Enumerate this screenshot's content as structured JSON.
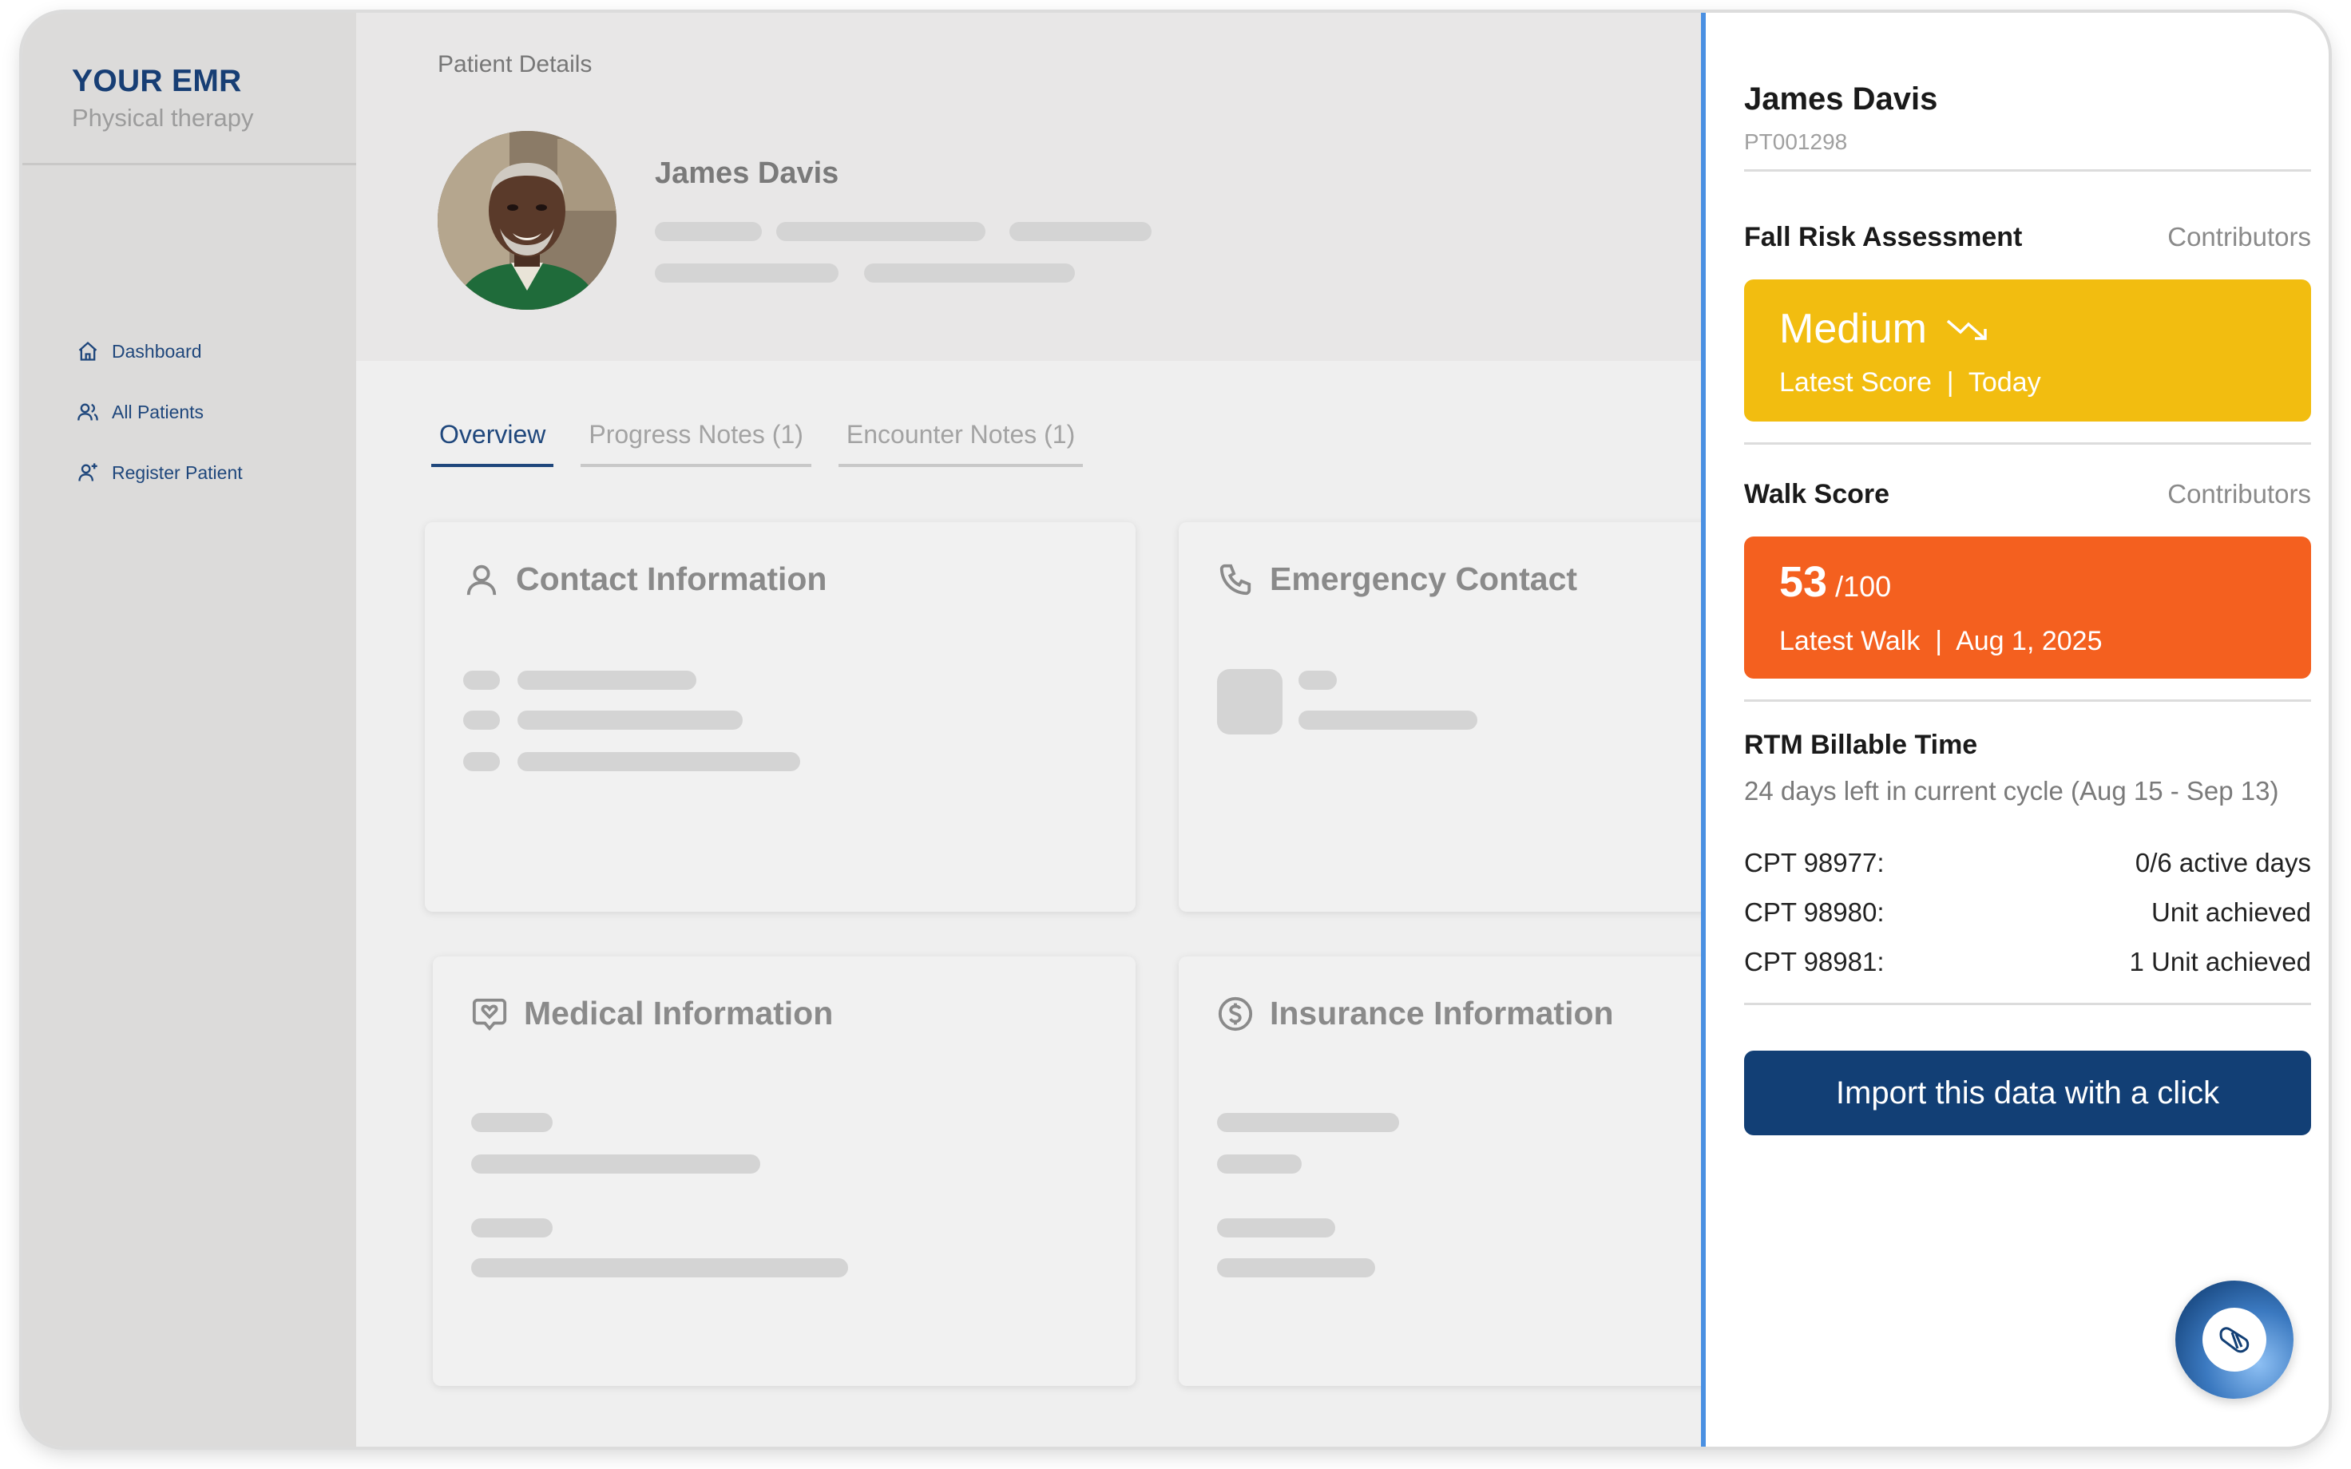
{
  "app": {
    "brand_title": "YOUR EMR",
    "brand_subtitle": "Physical therapy"
  },
  "sidebar": {
    "items": [
      {
        "label": "Dashboard",
        "icon": "home-icon"
      },
      {
        "label": "All Patients",
        "icon": "users-icon"
      },
      {
        "label": "Register Patient",
        "icon": "user-plus-icon"
      }
    ]
  },
  "main": {
    "page_title": "Patient Details",
    "patient_name": "James Davis",
    "tabs": [
      {
        "label": "Overview",
        "active": true
      },
      {
        "label": "Progress Notes (1)",
        "active": false
      },
      {
        "label": "Encounter Notes (1)",
        "active": false
      }
    ],
    "cards": {
      "contact": {
        "title": "Contact Information",
        "icon": "person-icon"
      },
      "emergency": {
        "title": "Emergency Contact",
        "icon": "phone-icon"
      },
      "medical": {
        "title": "Medical Information",
        "icon": "heart-chat-icon"
      },
      "insurance": {
        "title": "Insurance Information",
        "icon": "dollar-circle-icon"
      }
    }
  },
  "panel": {
    "patient_name": "James Davis",
    "patient_id": "PT001298",
    "fall_risk": {
      "title": "Fall Risk Assessment",
      "link": "Contributors",
      "level": "Medium",
      "trend_icon": "trending-down-icon",
      "sub": "Latest Score  |  Today",
      "color": "#f2bd10"
    },
    "walk_score": {
      "title": "Walk Score",
      "link": "Contributors",
      "value": "53",
      "max": "/100",
      "sub": "Latest Walk  |  Aug 1, 2025",
      "color": "#f4601f"
    },
    "rtm": {
      "title": "RTM Billable Time",
      "subtitle": "24 days left in current cycle (Aug 15 - Sep 13)",
      "rows": [
        {
          "code": "CPT 98977:",
          "status": "0/6 active days"
        },
        {
          "code": "CPT 98980:",
          "status": "Unit achieved"
        },
        {
          "code": "CPT 98981:",
          "status": "1 Unit achieved"
        }
      ]
    },
    "import_button": "Import this data with a click"
  },
  "colors": {
    "brand_navy": "#173e74",
    "button_navy": "#123f75",
    "panel_accent": "#4a90e2"
  }
}
